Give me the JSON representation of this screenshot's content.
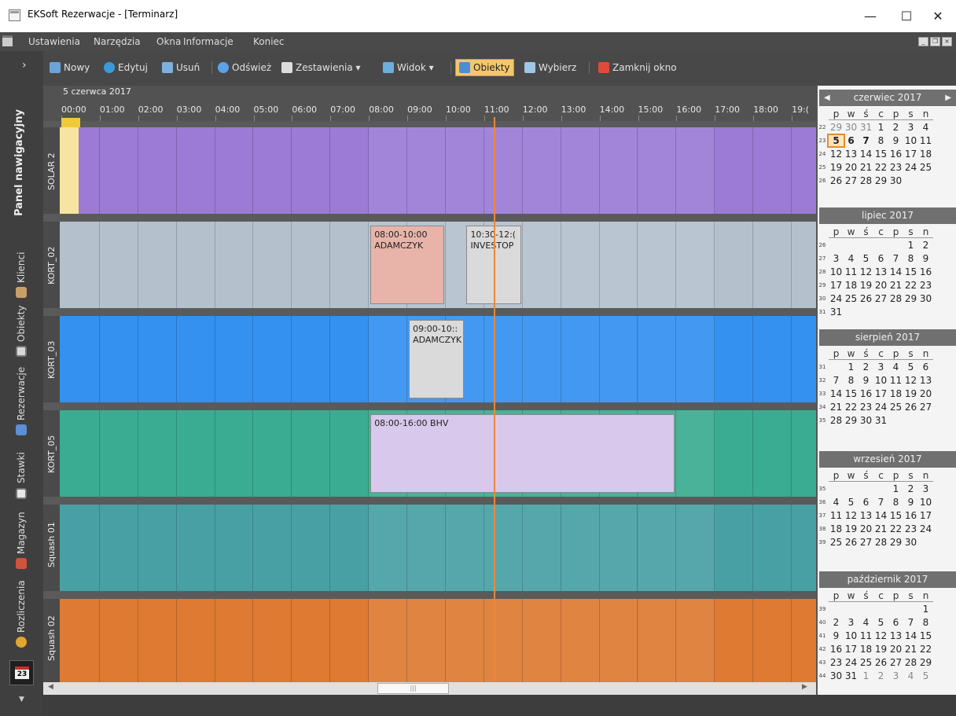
{
  "window": {
    "title": "EKSoft Rezerwacje - [Terminarz]",
    "minimize": "—",
    "maximize": "☐",
    "close": "✕"
  },
  "menu": [
    "Ustawienia",
    "Narzędzia",
    "Okna",
    "Informacje",
    "Koniec"
  ],
  "toolbar": {
    "expand_arrow": "›",
    "new": "Nowy",
    "edit": "Edytuj",
    "delete": "Usuń",
    "refresh": "Odśwież",
    "reports": "Zestawienia ▾",
    "view": "Widok ▾",
    "objects": "Obiekty",
    "select": "Wybierz",
    "close_window": "Zamknij okno"
  },
  "nav": {
    "title": "Panel nawigacyjny",
    "items": [
      "Klienci",
      "Obiekty",
      "Rezerwacje",
      "Stawki",
      "Magazyn",
      "Rozliczenia"
    ],
    "calendar_day": "23",
    "down_arrow": "▼"
  },
  "schedule": {
    "date": "5 czerwca 2017",
    "hours": [
      "00:00",
      "01:00",
      "02:00",
      "03:00",
      "04:00",
      "05:00",
      "06:00",
      "07:00",
      "08:00",
      "09:00",
      "10:00",
      "11:00",
      "12:00",
      "13:00",
      "14:00",
      "15:00",
      "16:00",
      "17:00",
      "18:00",
      "19:("
    ],
    "rows": [
      {
        "name": "SOLAR 2",
        "color": "#9b7bd6"
      },
      {
        "name": "KORT_02",
        "color": "#b4c1cd"
      },
      {
        "name": "KORT_03",
        "color": "#3491f0"
      },
      {
        "name": "KORT_05",
        "color": "#3aac91"
      },
      {
        "name": "Squash 01",
        "color": "#48a0a4"
      },
      {
        "name": "Squash 02",
        "color": "#de7a32"
      }
    ],
    "reservations": [
      {
        "time": "08:00-10:00",
        "client": "ADAMCZYK",
        "color": "#e8b4aa"
      },
      {
        "time": "10:30-12:(",
        "client": "INVESTOP",
        "color": "#dadada"
      },
      {
        "time": "09:00-10::",
        "client": "ADAMCZYK",
        "color": "#dadada"
      },
      {
        "time": "08:00-16:00 BHV",
        "client": "",
        "color": "#d8c8ec"
      }
    ],
    "scroll_thumb": "|||"
  },
  "calendar": {
    "months": [
      {
        "name": "czerwiec 2017",
        "dow": [
          "p",
          "w",
          "ś",
          "c",
          "p",
          "s",
          "n"
        ],
        "weeks": [
          {
            "wk": "22",
            "days": [
              "29",
              "30",
              "31",
              "1",
              "2",
              "3",
              "4"
            ]
          },
          {
            "wk": "23",
            "days": [
              "5",
              "6",
              "7",
              "8",
              "9",
              "10",
              "11"
            ]
          },
          {
            "wk": "24",
            "days": [
              "12",
              "13",
              "14",
              "15",
              "16",
              "17",
              "18"
            ]
          },
          {
            "wk": "25",
            "days": [
              "19",
              "20",
              "21",
              "22",
              "23",
              "24",
              "25"
            ]
          },
          {
            "wk": "26",
            "days": [
              "26",
              "27",
              "28",
              "29",
              "30",
              "",
              ""
            ]
          }
        ]
      },
      {
        "name": "lipiec 2017",
        "dow": [
          "p",
          "w",
          "ś",
          "c",
          "p",
          "s",
          "n"
        ],
        "weeks": [
          {
            "wk": "26",
            "days": [
              "",
              "",
              "",
              "",
              "",
              "1",
              "2"
            ]
          },
          {
            "wk": "27",
            "days": [
              "3",
              "4",
              "5",
              "6",
              "7",
              "8",
              "9"
            ]
          },
          {
            "wk": "28",
            "days": [
              "10",
              "11",
              "12",
              "13",
              "14",
              "15",
              "16"
            ]
          },
          {
            "wk": "29",
            "days": [
              "17",
              "18",
              "19",
              "20",
              "21",
              "22",
              "23"
            ]
          },
          {
            "wk": "30",
            "days": [
              "24",
              "25",
              "26",
              "27",
              "28",
              "29",
              "30"
            ]
          },
          {
            "wk": "31",
            "days": [
              "31",
              "",
              "",
              "",
              "",
              "",
              ""
            ]
          }
        ]
      },
      {
        "name": "sierpień 2017",
        "dow": [
          "p",
          "w",
          "ś",
          "c",
          "p",
          "s",
          "n"
        ],
        "weeks": [
          {
            "wk": "31",
            "days": [
              "",
              "1",
              "2",
              "3",
              "4",
              "5",
              "6"
            ]
          },
          {
            "wk": "32",
            "days": [
              "7",
              "8",
              "9",
              "10",
              "11",
              "12",
              "13"
            ]
          },
          {
            "wk": "33",
            "days": [
              "14",
              "15",
              "16",
              "17",
              "18",
              "19",
              "20"
            ]
          },
          {
            "wk": "34",
            "days": [
              "21",
              "22",
              "23",
              "24",
              "25",
              "26",
              "27"
            ]
          },
          {
            "wk": "35",
            "days": [
              "28",
              "29",
              "30",
              "31",
              "",
              "",
              ""
            ]
          }
        ]
      },
      {
        "name": "wrzesień 2017",
        "dow": [
          "p",
          "w",
          "ś",
          "c",
          "p",
          "s",
          "n"
        ],
        "weeks": [
          {
            "wk": "35",
            "days": [
              "",
              "",
              "",
              "",
              "1",
              "2",
              "3"
            ]
          },
          {
            "wk": "36",
            "days": [
              "4",
              "5",
              "6",
              "7",
              "8",
              "9",
              "10"
            ]
          },
          {
            "wk": "37",
            "days": [
              "11",
              "12",
              "13",
              "14",
              "15",
              "16",
              "17"
            ]
          },
          {
            "wk": "38",
            "days": [
              "18",
              "19",
              "20",
              "21",
              "22",
              "23",
              "24"
            ]
          },
          {
            "wk": "39",
            "days": [
              "25",
              "26",
              "27",
              "28",
              "29",
              "30",
              ""
            ]
          }
        ]
      },
      {
        "name": "październik 2017",
        "dow": [
          "p",
          "w",
          "ś",
          "c",
          "p",
          "s",
          "n"
        ],
        "weeks": [
          {
            "wk": "39",
            "days": [
              "",
              "",
              "",
              "",
              "",
              "",
              "1"
            ]
          },
          {
            "wk": "40",
            "days": [
              "2",
              "3",
              "4",
              "5",
              "6",
              "7",
              "8"
            ]
          },
          {
            "wk": "41",
            "days": [
              "9",
              "10",
              "11",
              "12",
              "13",
              "14",
              "15"
            ]
          },
          {
            "wk": "42",
            "days": [
              "16",
              "17",
              "18",
              "19",
              "20",
              "21",
              "22"
            ]
          },
          {
            "wk": "43",
            "days": [
              "23",
              "24",
              "25",
              "26",
              "27",
              "28",
              "29"
            ]
          },
          {
            "wk": "44",
            "days": [
              "30",
              "31",
              "1",
              "2",
              "3",
              "4",
              "5"
            ]
          }
        ]
      }
    ],
    "prev_arrow": "◀",
    "next_arrow": "▶",
    "today": "5",
    "bold_days": [
      "6",
      "7"
    ]
  }
}
